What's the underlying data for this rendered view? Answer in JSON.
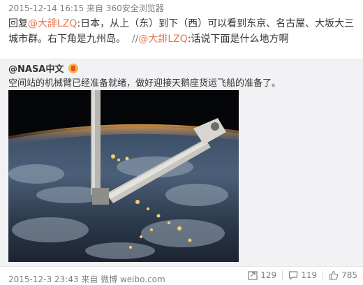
{
  "reply": {
    "timestamp": "2015-12-14 16:15",
    "source_prefix": "来自",
    "source": "360安全浏览器",
    "prefix": "回复",
    "mention1": "@大誹LZQ",
    "body": ":日本，从上（东）到下（西）可以看到东京、名古屋、大坂大三城市群。右下角是九州岛。",
    "separator": "//",
    "mention2": "@大誹LZQ",
    "body2": ":话说下面是什么地方啊"
  },
  "original": {
    "author": "@NASA中文",
    "text": "空间站的机械臂已经准备就绪，做好迎接天鹅座货运飞船的准备了。",
    "photo_icon": "earth-night-photo-from-iss",
    "timestamp": "2015-12-3 23:43",
    "source_prefix": "来自",
    "source": "微博 weibo.com",
    "repost_count": "129",
    "comment_count": "119",
    "like_count": "785",
    "icons": {
      "repost": "repost-icon",
      "comment": "comment-icon",
      "like": "thumbs-up-icon",
      "badge": "vip-badge-icon"
    }
  },
  "colors": {
    "link": "#eb7350",
    "meta": "#808080",
    "repost_bg": "#f2f2f5"
  }
}
